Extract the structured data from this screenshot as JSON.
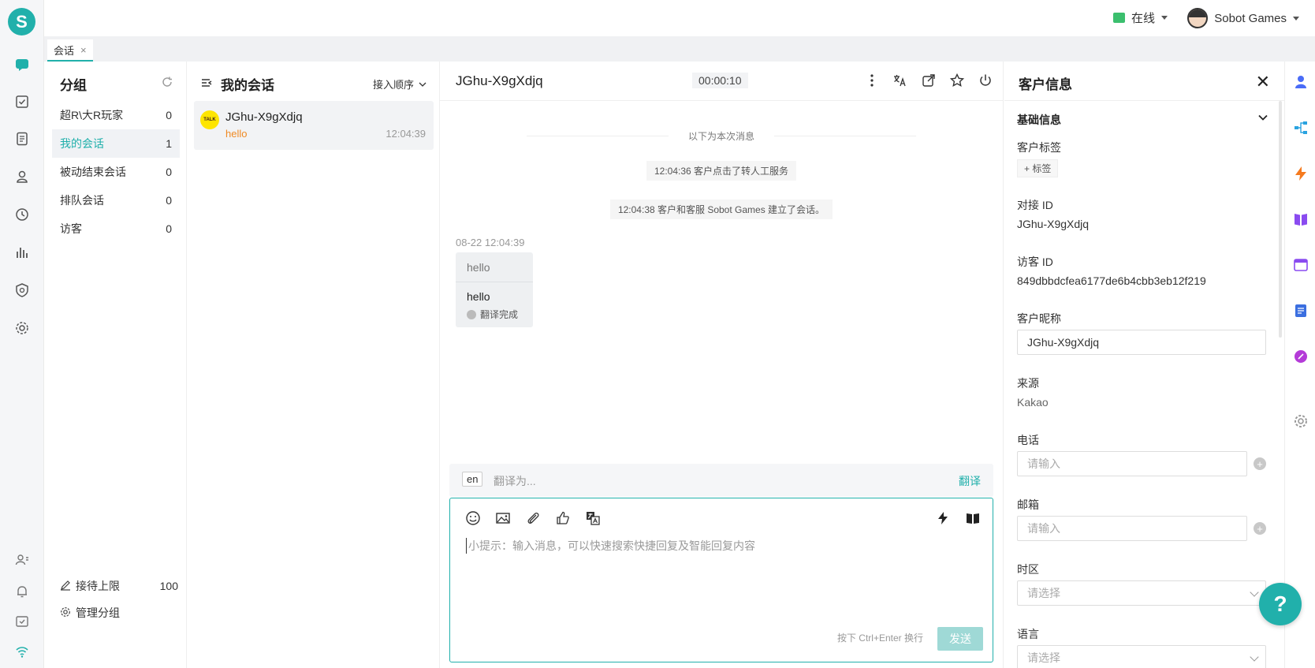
{
  "app": {
    "logo_letter": "S"
  },
  "topbar": {
    "status": "在线",
    "user": "Sobot Games"
  },
  "tabs": [
    {
      "label": "会话",
      "close": "×"
    }
  ],
  "groups": {
    "title": "分组",
    "items": [
      {
        "label": "超R\\大R玩家",
        "count": "0"
      },
      {
        "label": "我的会话",
        "count": "1"
      },
      {
        "label": "被动结束会话",
        "count": "0"
      },
      {
        "label": "排队会话",
        "count": "0"
      },
      {
        "label": "访客",
        "count": "0"
      }
    ],
    "limit_label": "接待上限",
    "limit_value": "100",
    "manage_label": "管理分组"
  },
  "sessions": {
    "title": "我的会话",
    "order": "接入顺序",
    "items": [
      {
        "name": "JGhu-X9gXdjq",
        "message": "hello",
        "time": "12:04:39",
        "channel_badge": "TALK"
      }
    ]
  },
  "chat": {
    "title": "JGhu-X9gXdjq",
    "timer": "00:00:10",
    "divider": "以下为本次消息",
    "system": [
      "12:04:36 客户点击了转人工服务",
      "12:04:38 客户和客服 Sobot Games 建立了会话。"
    ],
    "message_time": "08-22 12:04:39",
    "message_original": "hello",
    "message_translated": "hello",
    "translate_status": "翻译完成",
    "translate_lang": "en",
    "translate_placeholder": "翻译为...",
    "translate_button": "翻译",
    "composer_placeholder": "小提示：输入消息，可以快速搜索快捷回复及智能回复内容",
    "hint": "按下 Ctrl+Enter 换行",
    "send": "发送"
  },
  "info": {
    "title": "客户信息",
    "section": "基础信息",
    "tag_label": "客户标签",
    "tag_button": "+ 标签",
    "contact_id_label": "对接 ID",
    "contact_id": "JGhu-X9gXdjq",
    "visitor_id_label": "访客 ID",
    "visitor_id": "849dbbdcfea6177de6b4cbb3eb12f219",
    "nickname_label": "客户昵称",
    "nickname": "JGhu-X9gXdjq",
    "source_label": "来源",
    "source": "Kakao",
    "phone_label": "电话",
    "phone_placeholder": "请输入",
    "email_label": "邮箱",
    "email_placeholder": "请输入",
    "timezone_label": "时区",
    "timezone_placeholder": "请选择",
    "language_label": "语言",
    "language_placeholder": "请选择"
  },
  "colors": {
    "accent": "#21b0ab",
    "online": "#3bbf6e",
    "kakao": "#fee500"
  }
}
